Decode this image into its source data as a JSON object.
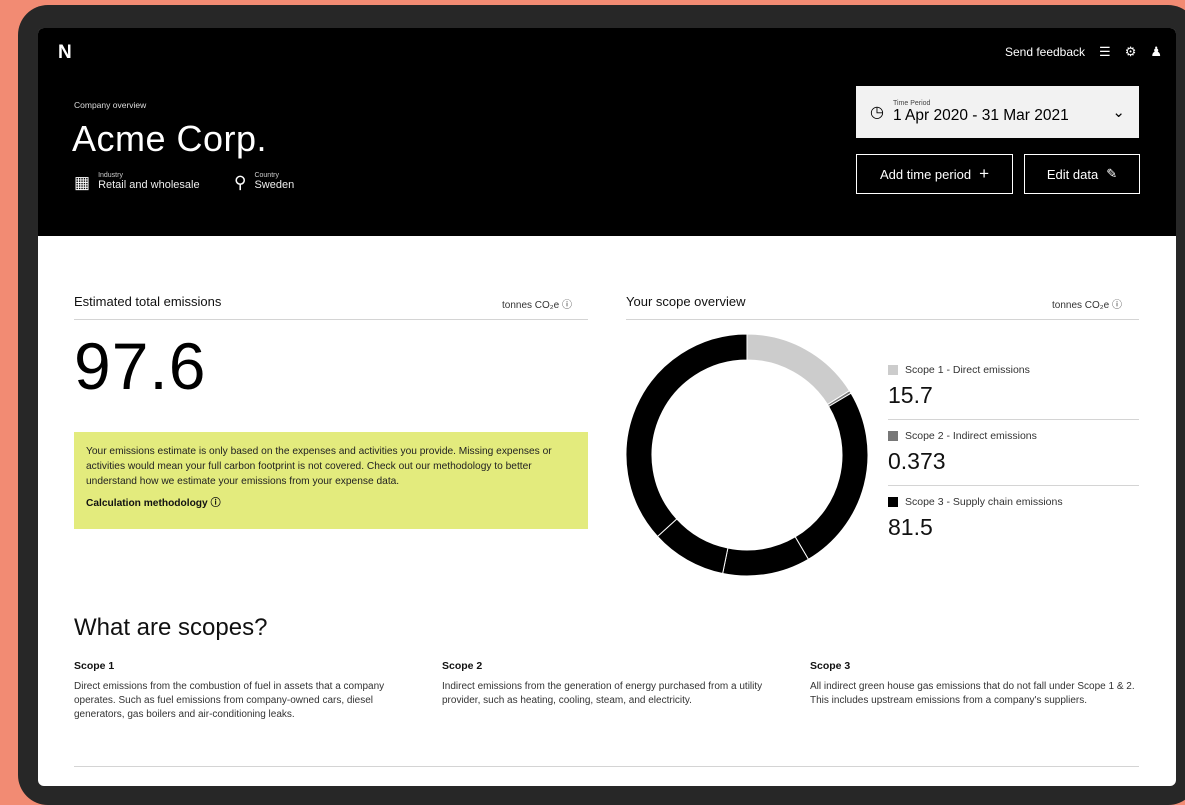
{
  "header": {
    "logo": "N",
    "send_feedback": "Send feedback",
    "overline": "Company overview",
    "company_name": "Acme Corp.",
    "industry_label": "Industry",
    "industry_value": "Retail and wholesale",
    "country_label": "Country",
    "country_value": "Sweden",
    "time_period_label": "Time Period",
    "time_period_value": "1 Apr 2020 - 31 Mar 2021",
    "add_time_period": "Add time period",
    "edit_data": "Edit data"
  },
  "total_panel": {
    "title": "Estimated total emissions",
    "unit": "tonnes CO₂e",
    "value": "97.6",
    "notice": "Your emissions estimate is only based on the expenses and activities you provide. Missing expenses or activities would mean your full carbon footprint is not covered. Check out our methodology to better understand how we estimate your emissions from your expense data.",
    "methodology_link": "Calculation methodology"
  },
  "scope_panel": {
    "title": "Your scope overview",
    "unit": "tonnes CO₂e",
    "items": [
      {
        "label": "Scope 1 - Direct emissions",
        "value": "15.7",
        "color": "#cccccc"
      },
      {
        "label": "Scope 2 - Indirect emissions",
        "value": "0.373",
        "color": "#777777"
      },
      {
        "label": "Scope 3 - Supply chain emissions",
        "value": "81.5",
        "color": "#000000"
      }
    ]
  },
  "chart_data": {
    "type": "pie",
    "categories": [
      "Scope 1 - Direct emissions",
      "Scope 2 - Indirect emissions",
      "Scope 3 - Supply chain emissions"
    ],
    "values": [
      15.7,
      0.373,
      81.5
    ],
    "colors": [
      "#cccccc",
      "#777777",
      "#000000"
    ],
    "scope3_subsegments": 4
  },
  "scopes_info": {
    "title": "What are scopes?",
    "items": [
      {
        "heading": "Scope 1",
        "text": "Direct emissions from the combustion of fuel in assets that a company operates. Such as fuel emissions from company-owned cars, diesel generators, gas boilers and air-conditioning leaks."
      },
      {
        "heading": "Scope 2",
        "text": "Indirect emissions from the generation of energy purchased from a utility provider, such as heating, cooling, steam, and electricity."
      },
      {
        "heading": "Scope 3",
        "text": "All indirect green house gas emissions that do not fall under Scope 1 & 2. This includes upstream emissions from a company's suppliers."
      }
    ]
  },
  "colors": {
    "background": "#f28b73",
    "device": "#272727",
    "header": "#000000",
    "notice": "#e3eb7d"
  }
}
